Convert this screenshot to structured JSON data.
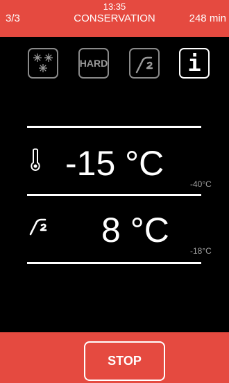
{
  "header": {
    "time": "13:35",
    "step": "3/3",
    "phase": "CONSERVATION",
    "remaining": "248 min"
  },
  "modes": [
    {
      "icon": "snowflakes-icon",
      "active": false
    },
    {
      "icon": "hard-icon",
      "label": "HARD",
      "active": false
    },
    {
      "icon": "core-probe-icon",
      "active": false
    },
    {
      "icon": "info-icon",
      "label": "i",
      "active": true
    }
  ],
  "cabinet": {
    "icon": "thermometer-icon",
    "value": "-15 °C",
    "setpoint": "-40°C"
  },
  "probe": {
    "icon": "core-probe-icon",
    "value": "8 °C",
    "setpoint": "-18°C"
  },
  "footer": {
    "stop_label": "STOP"
  },
  "colors": {
    "accent": "#e54a40",
    "background": "#000000",
    "text": "#ffffff",
    "muted": "#a0a0a0"
  }
}
